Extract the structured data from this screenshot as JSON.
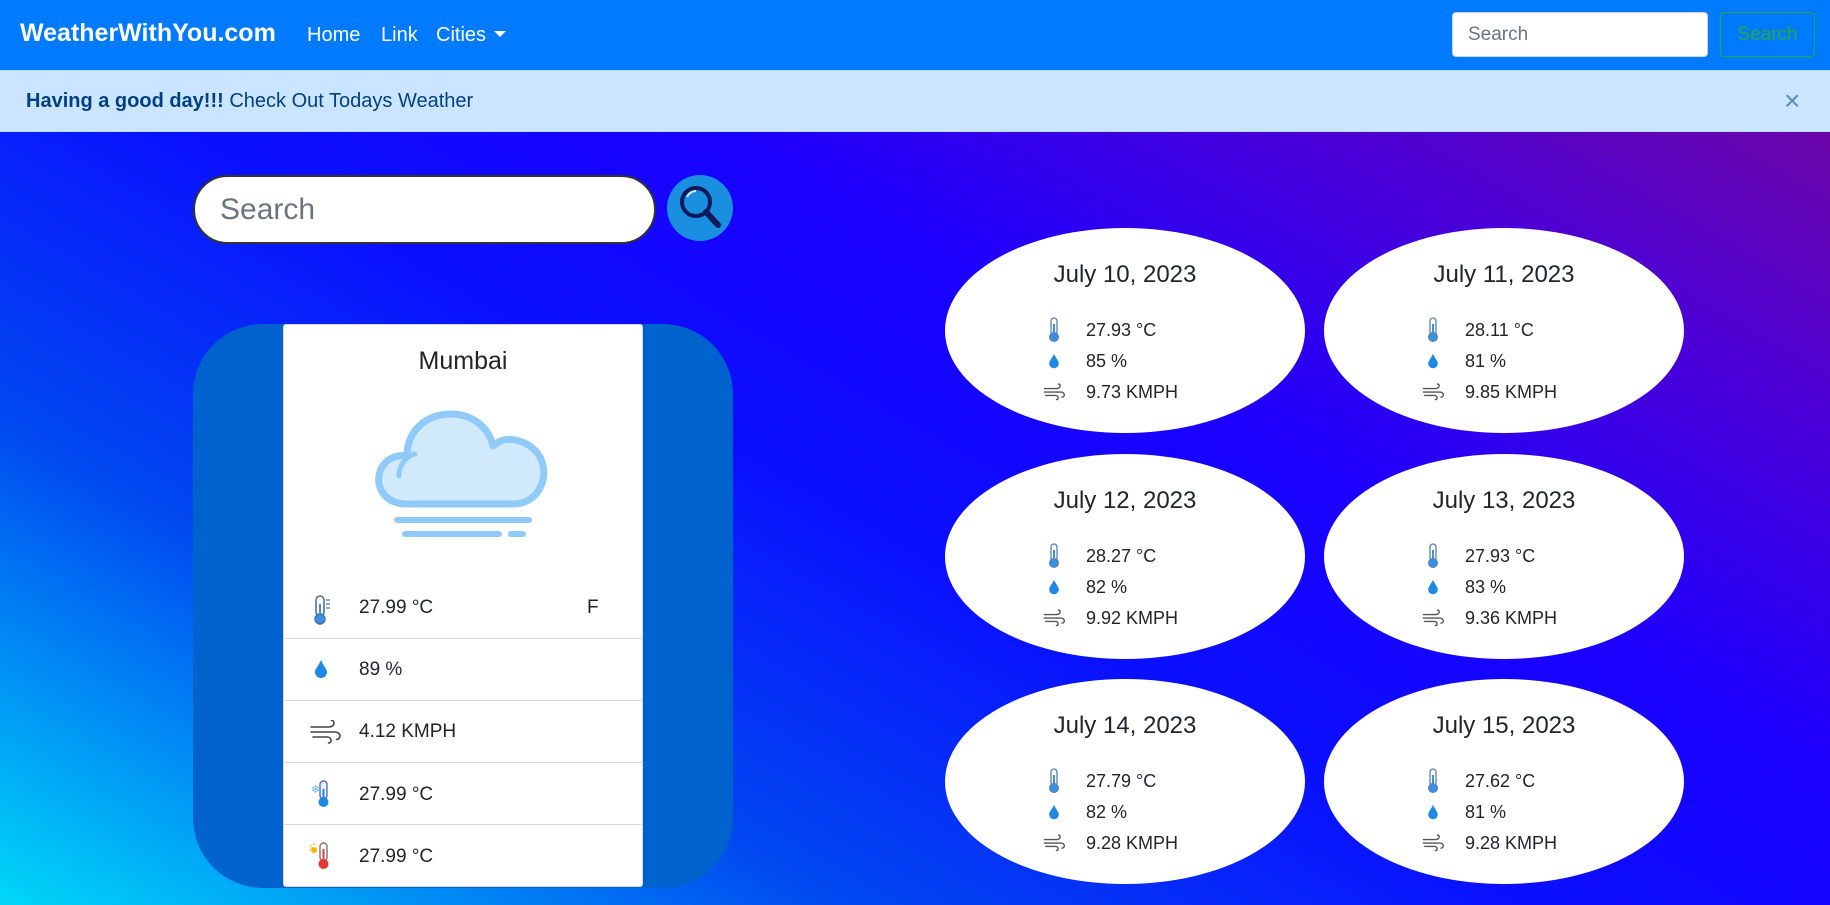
{
  "navbar": {
    "brand": "WeatherWithYou.com",
    "links": [
      "Home",
      "Link",
      "Cities"
    ],
    "search_placeholder": "Search",
    "search_button": "Search"
  },
  "alert": {
    "strong": "Having a good day!!!",
    "text": "Check Out Todays Weather",
    "close": "×"
  },
  "main_search": {
    "placeholder": "Search"
  },
  "current": {
    "city": "Mumbai",
    "temp": "27.99 °C",
    "unit_toggle": "F",
    "humidity": "89 %",
    "wind": "4.12 KMPH",
    "min_temp": "27.99 °C",
    "max_temp": "27.99 °C"
  },
  "forecast": [
    {
      "date": "July 10, 2023",
      "temp": "27.93 °C",
      "humidity": "85 %",
      "wind": "9.73 KMPH"
    },
    {
      "date": "July 11, 2023",
      "temp": "28.11 °C",
      "humidity": "81 %",
      "wind": "9.85 KMPH"
    },
    {
      "date": "July 12, 2023",
      "temp": "28.27 °C",
      "humidity": "82 %",
      "wind": "9.92 KMPH"
    },
    {
      "date": "July 13, 2023",
      "temp": "27.93 °C",
      "humidity": "83 %",
      "wind": "9.36 KMPH"
    },
    {
      "date": "July 14, 2023",
      "temp": "27.79 °C",
      "humidity": "82 %",
      "wind": "9.28 KMPH"
    },
    {
      "date": "July 15, 2023",
      "temp": "27.62 °C",
      "humidity": "81 %",
      "wind": "9.28 KMPH"
    }
  ],
  "colors": {
    "navbar": "#007bff",
    "alert_bg": "#cce5ff",
    "alert_text": "#004085",
    "card_back": "#0062cc",
    "search_button": "#1a8fe0",
    "nav_search_button": "#28a745"
  },
  "icons": {
    "search": "magnifier-icon",
    "weather": "cloud-fog-icon",
    "temp": "thermometer-icon",
    "humidity": "droplet-icon",
    "wind": "wind-icon",
    "min_temp": "thermometer-cold-icon",
    "max_temp": "thermometer-hot-icon"
  }
}
